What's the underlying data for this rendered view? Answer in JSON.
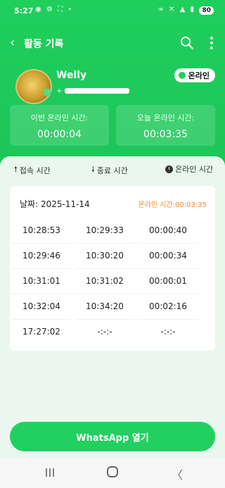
{
  "status_bar": {
    "time": "5:27",
    "left_icons": "◉ ⚙ ⛶ •",
    "right_icons": "∞ ✕ ▲ ▮",
    "battery": "80"
  },
  "topbar": {
    "back_icon": "chevron-left-icon",
    "title": "활동 기록"
  },
  "profile": {
    "name": "Welly",
    "phone_prefix": "+",
    "status_label": "온라인"
  },
  "stats": [
    {
      "label": "이번 온라인 시간:",
      "value": "00:00:04"
    },
    {
      "label": "오늘 온라인 시간:",
      "value": "00:03:35"
    }
  ],
  "columns": {
    "connect": "접속 시간",
    "end": "종료 시간",
    "online": "온라인 시간"
  },
  "session": {
    "date_label": "날짜: 2025-11-14",
    "online_total": "온라인 시간:00:03:35",
    "rows": [
      [
        "10:28:53",
        "10:29:33",
        "00:00:40"
      ],
      [
        "10:29:46",
        "10:30:20",
        "00:00:34"
      ],
      [
        "10:31:01",
        "10:31:02",
        "00:00:01"
      ],
      [
        "10:32:04",
        "10:34:20",
        "00:02:16"
      ],
      [
        "17:27:02",
        "-:-:-",
        "-:-:-"
      ]
    ]
  },
  "action": {
    "open_whatsapp": "WhatsApp 열기"
  },
  "nav": {
    "back_glyph": "〈"
  },
  "colors": {
    "brand": "#1fcf5c",
    "accent_orange": "#ef8a1d"
  }
}
